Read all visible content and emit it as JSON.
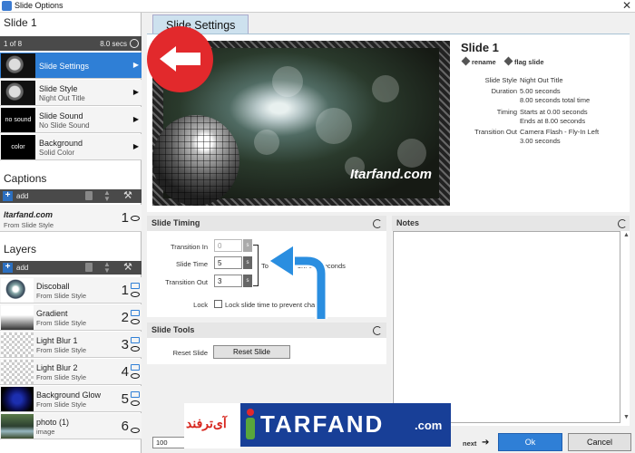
{
  "window": {
    "title": "Slide Options",
    "close": "✕"
  },
  "slide_header": {
    "title": "Slide 1",
    "position": "1 of 8",
    "duration": "8.0 secs"
  },
  "slide_items": [
    {
      "name": "Slide Settings",
      "sub": "",
      "thumb": ""
    },
    {
      "name": "Slide Style",
      "sub": "Night Out Title",
      "thumb": ""
    },
    {
      "name": "Slide Sound",
      "sub": "No Slide Sound",
      "thumb": "no sound"
    },
    {
      "name": "Background",
      "sub": "Solid Color",
      "thumb": "color"
    }
  ],
  "captions": {
    "title": "Captions",
    "add": "add",
    "items": [
      {
        "name": "Itarfand.com",
        "sub": "From Slide Style",
        "num": "1"
      }
    ]
  },
  "layers": {
    "title": "Layers",
    "add": "add",
    "items": [
      {
        "name": "Discoball",
        "sub": "From Slide Style",
        "num": "1"
      },
      {
        "name": "Gradient",
        "sub": "From Slide Style",
        "num": "2"
      },
      {
        "name": "Light Blur 1",
        "sub": "From Slide Style",
        "num": "3"
      },
      {
        "name": "Light Blur 2",
        "sub": "From Slide Style",
        "num": "4"
      },
      {
        "name": "Background Glow",
        "sub": "From Slide Style",
        "num": "5"
      },
      {
        "name": "photo (1)",
        "sub": "image",
        "num": "6"
      }
    ]
  },
  "tab": {
    "label": "Slide Settings"
  },
  "preview": {
    "watermark": "Itarfand.com"
  },
  "info": {
    "title": "Slide 1",
    "rename": "rename",
    "flag": "flag slide",
    "rows": [
      {
        "k": "Slide Style",
        "v1": "Night Out Title",
        "v2": ""
      },
      {
        "k": "Duration",
        "v1": "5.00 seconds",
        "v2": "8.00 seconds total time"
      },
      {
        "k": "Timing",
        "v1": "Starts at 0.00 seconds",
        "v2": "Ends at 8.00 seconds"
      },
      {
        "k": "Transition Out",
        "v1": "Camera Flash - Fly-In Left",
        "v2": "3.00 seconds"
      }
    ]
  },
  "timing": {
    "title": "Slide Timing",
    "transition_in_label": "Transition In",
    "transition_in_value": "0",
    "slide_time_label": "Slide Time",
    "slide_time_value": "5",
    "transition_out_label": "Transition Out",
    "transition_out_value": "3",
    "unit": "s",
    "total_prefix": "To",
    "total_suffix": "on: 8.0 seconds",
    "lock_label": "Lock",
    "lock_text": "Lock slide time to prevent cha",
    "lock_text_tail": "s"
  },
  "tools": {
    "title": "Slide Tools",
    "reset_label": "Reset Slide",
    "reset_button": "Reset Slide"
  },
  "notes": {
    "title": "Notes"
  },
  "bottom": {
    "zoom": "100",
    "play": "play",
    "next": "next",
    "ok": "Ok",
    "cancel": "Cancel"
  },
  "banner": {
    "fa": "آی‌ترفند",
    "letters": "TARFAND",
    "com": ".com"
  },
  "colors": {
    "accent": "#2f7fd6",
    "header_dark": "#4a4a4a",
    "back_arrow": "#e2292c",
    "banner_blue": "#183f97"
  }
}
